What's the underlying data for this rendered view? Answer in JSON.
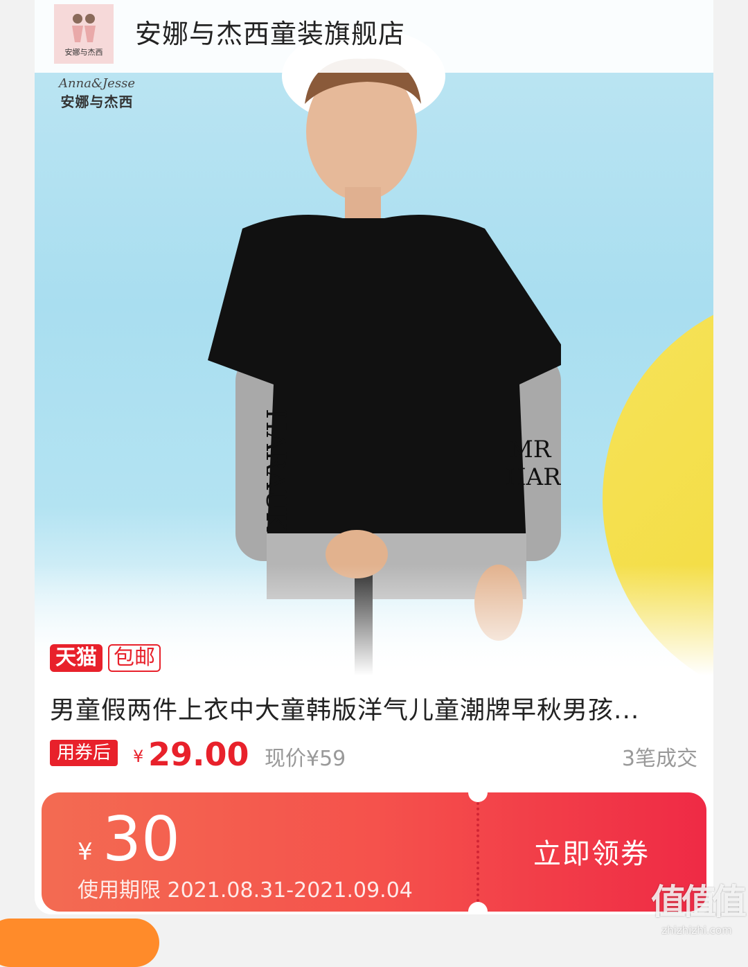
{
  "store": {
    "name": "安娜与杰西童装旗舰店",
    "logo_text": "安娜与杰西"
  },
  "product": {
    "watermark_en": "Anna&Jesse",
    "watermark_cn": "安娜与杰西",
    "tag_tmall": "天猫",
    "tag_shipping": "包邮",
    "title": "男童假两件上衣中大童韩版洋气儿童潮牌早秋男孩...",
    "coupon_label": "用券后",
    "currency": "¥",
    "final_price": "29.00",
    "original_price": "现价¥59",
    "sales": "3笔成交"
  },
  "coupon": {
    "currency": "¥",
    "amount": "30",
    "validity": "使用期限 2021.08.31-2021.09.04",
    "claim_label": "立即领券"
  },
  "site_watermark": {
    "logo": "值值值",
    "url": "zhizhizhi.com"
  },
  "colors": {
    "accent_red": "#e8212b",
    "coupon_gradient_start": "#f36b52",
    "coupon_gradient_end": "#ef2a45",
    "background_blue": "#a9def0",
    "background_yellow": "#f2d832"
  }
}
